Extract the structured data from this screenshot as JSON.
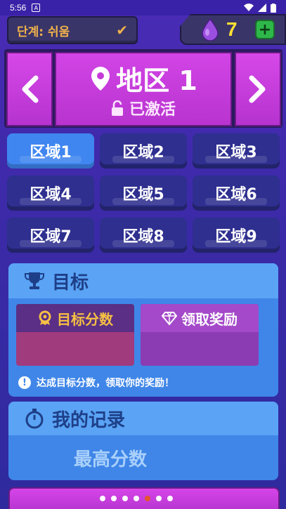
{
  "status_bar": {
    "time": "5:56",
    "notification_glyph": "A"
  },
  "difficulty": {
    "label": "단계: 쉬움"
  },
  "currency": {
    "value": "7",
    "plus_label": "+"
  },
  "region": {
    "title": "地区 1",
    "status": "已激活",
    "prev_label": "‹",
    "next_label": "›"
  },
  "zones": [
    {
      "label": "区域1"
    },
    {
      "label": "区域2"
    },
    {
      "label": "区域3"
    },
    {
      "label": "区域4"
    },
    {
      "label": "区域5"
    },
    {
      "label": "区域6"
    },
    {
      "label": "区域7"
    },
    {
      "label": "区域8"
    },
    {
      "label": "区域9"
    }
  ],
  "goal": {
    "title": "目标",
    "score_label": "目标分数",
    "reward_label": "领取奖励",
    "hint": "达成目标分数，领取你的奖励！"
  },
  "record": {
    "title": "我的记录",
    "best_score_label": "最高分数"
  },
  "pager": {
    "active_index": 4,
    "count": 7
  },
  "colors": {
    "background": "#3c2aa8",
    "region_magenta": "#d244e6",
    "zone_active": "#3f86f0",
    "zone_default": "#2e2f8f",
    "panel_blue": "#3f86e8",
    "currency_yellow": "#ffe033",
    "difficulty_orange": "#f0b24a"
  }
}
